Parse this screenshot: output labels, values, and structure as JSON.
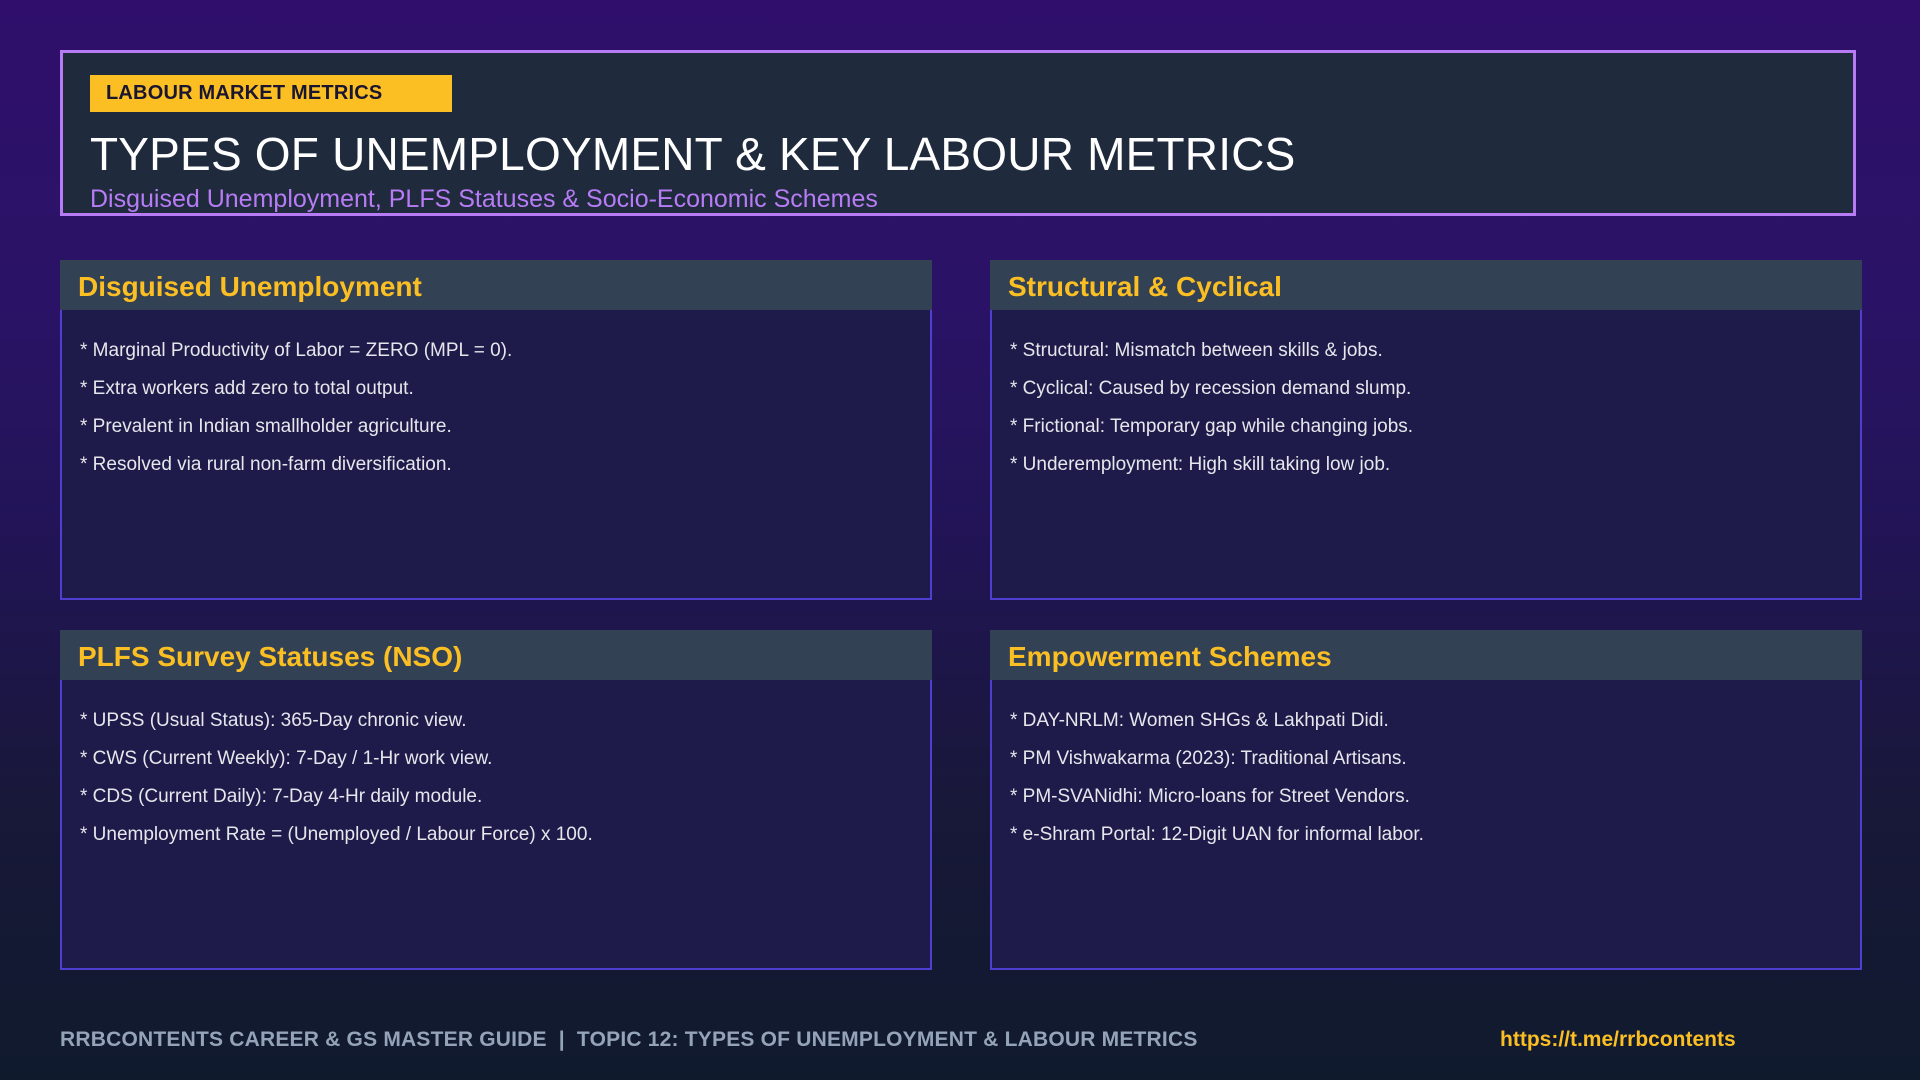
{
  "header": {
    "tag": "LABOUR MARKET METRICS",
    "title": "TYPES OF UNEMPLOYMENT & KEY LABOUR METRICS",
    "subtitle": "Disguised Unemployment, PLFS Statuses & Socio-Economic Schemes"
  },
  "cards": [
    {
      "title": "Disguised Unemployment",
      "items": [
        "* Marginal Productivity of Labor = ZERO (MPL = 0).",
        "* Extra workers add zero to total output.",
        "* Prevalent in Indian smallholder agriculture.",
        "* Resolved via rural non-farm diversification."
      ]
    },
    {
      "title": "Structural & Cyclical",
      "items": [
        "* Structural: Mismatch between skills & jobs.",
        "* Cyclical: Caused by recession demand slump.",
        "* Frictional: Temporary gap while changing jobs.",
        "* Underemployment: High skill taking low job."
      ]
    },
    {
      "title": "PLFS Survey Statuses (NSO)",
      "items": [
        "* UPSS (Usual Status): 365-Day chronic view.",
        "* CWS (Current Weekly): 7-Day / 1-Hr work view.",
        "* CDS (Current Daily): 7-Day 4-Hr daily module.",
        "* Unemployment Rate = (Unemployed / Labour Force) x 100."
      ]
    },
    {
      "title": "Empowerment Schemes",
      "items": [
        "* DAY-NRLM: Women SHGs & Lakhpati Didi.",
        "* PM Vishwakarma (2023): Traditional Artisans.",
        "* PM-SVANidhi: Micro-loans for Street Vendors.",
        "* e-Shram Portal: 12-Digit UAN for informal labor."
      ]
    }
  ],
  "footer": {
    "left": "RRBCONTENTS CAREER & GS MASTER GUIDE  |  TOPIC 12: TYPES OF UNEMPLOYMENT & LABOUR METRICS",
    "link": "https://t.me/rrbcontents"
  },
  "colors": {
    "accent": "#fbbf24",
    "header_border": "#b77cf5",
    "card_border": "#4f3fd1",
    "card_bg": "#1e1b4b",
    "card_header_bg": "#334155"
  }
}
